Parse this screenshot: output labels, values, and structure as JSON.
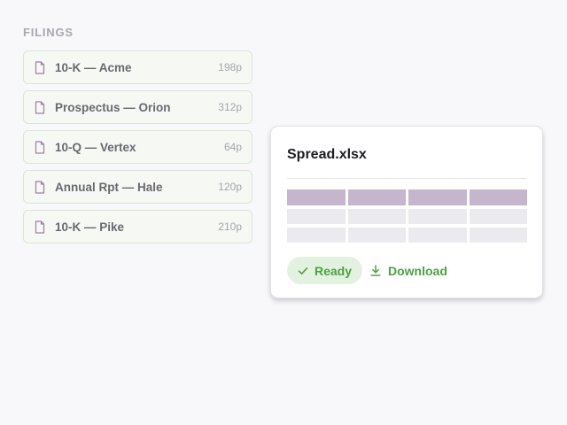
{
  "filings_panel": {
    "title": "FILINGS",
    "items": [
      {
        "name": "10-K — Acme",
        "pages": "198p",
        "icon": "document-icon"
      },
      {
        "name": "Prospectus — Orion",
        "pages": "312p",
        "icon": "document-icon"
      },
      {
        "name": "10-Q — Vertex",
        "pages": "64p",
        "icon": "document-icon"
      },
      {
        "name": "Annual Rpt — Hale",
        "pages": "120p",
        "icon": "document-icon"
      },
      {
        "name": "10-K — Pike",
        "pages": "210p",
        "icon": "document-icon"
      }
    ]
  },
  "preview": {
    "file_name": "Spread.xlsx",
    "sheet_thumbnail": {
      "columns": 4,
      "rows": 3,
      "header_rows": 1
    },
    "status": {
      "label": "Ready",
      "icon": "check-icon"
    },
    "download": {
      "label": "Download",
      "icon": "download-icon"
    }
  },
  "colors": {
    "accent_green": "#4ca043",
    "badge_background": "#e3f2e0",
    "sheet_header": "#c5b6cd",
    "file_icon": "#9a7fa6"
  }
}
